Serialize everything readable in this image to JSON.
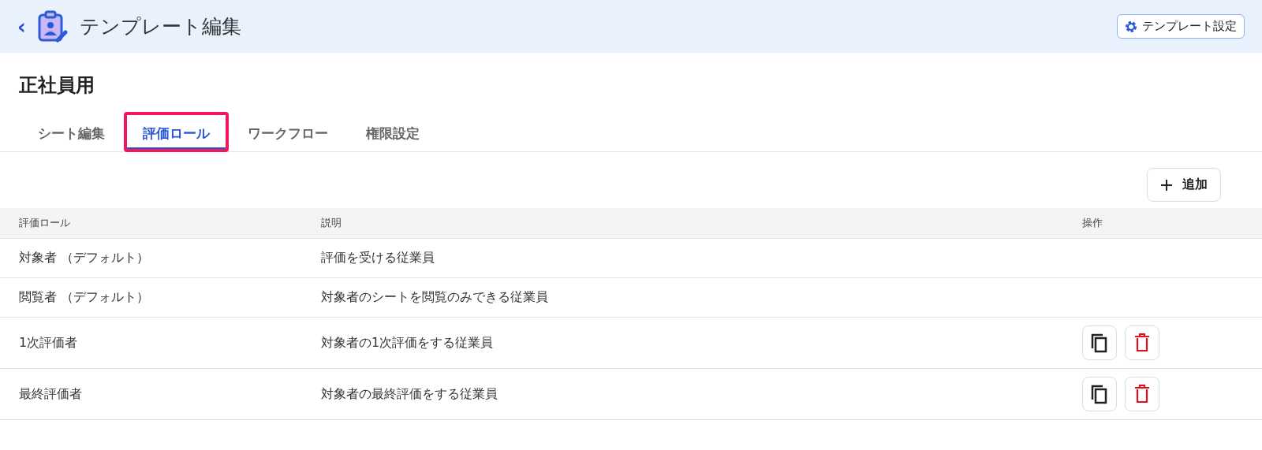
{
  "header": {
    "back": "‹",
    "title": "テンプレート編集",
    "settings_button": "テンプレート設定"
  },
  "page_title": "正社員用",
  "tabs": [
    {
      "label": "シート編集",
      "selected": false,
      "highlighted": false
    },
    {
      "label": "評価ロール",
      "selected": true,
      "highlighted": true
    },
    {
      "label": "ワークフロー",
      "selected": false,
      "highlighted": false
    },
    {
      "label": "権限設定",
      "selected": false,
      "highlighted": false
    }
  ],
  "add_button": "追加",
  "table": {
    "columns": [
      "評価ロール",
      "説明",
      "操作"
    ],
    "rows": [
      {
        "role": "対象者 （デフォルト）",
        "description": "評価を受ける従業員",
        "actions": false
      },
      {
        "role": "閲覧者 （デフォルト）",
        "description": "対象者のシートを閲覧のみできる従業員",
        "actions": false
      },
      {
        "role": "1次評価者",
        "description": "対象者の1次評価をする従業員",
        "actions": true
      },
      {
        "role": "最終評価者",
        "description": "対象者の最終評価をする従業員",
        "actions": true
      }
    ]
  }
}
